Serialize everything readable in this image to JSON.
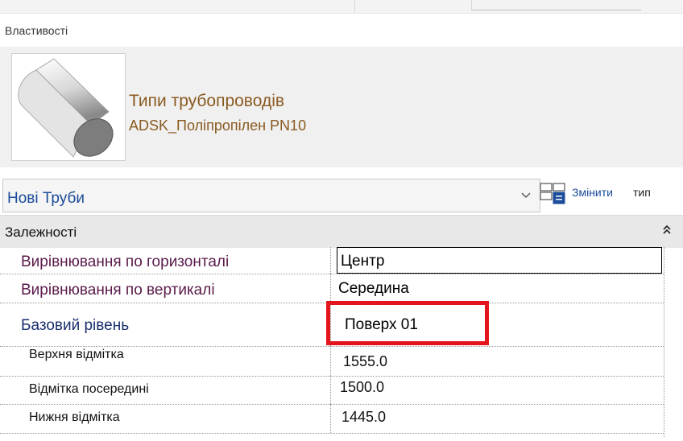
{
  "panel": {
    "title": "Властивості"
  },
  "type_header": {
    "family": "Типи трубопроводів",
    "name": "ADSK_Поліпропілен PN10",
    "thumbnail_icon": "pipe-cylinder-icon"
  },
  "type_selector": {
    "value": "Нові Труби",
    "edit_type_label": "Змінити",
    "edit_type_suffix": "тип"
  },
  "group": {
    "label": "Залежності",
    "collapse_glyph": "⌃"
  },
  "properties": [
    {
      "name": "Вирівнювання по горизонталі",
      "value": "Центр"
    },
    {
      "name": "Вирівнювання по вертикалі",
      "value": "Середина"
    },
    {
      "name": "Базовий рівень",
      "value": "Поверх 01"
    },
    {
      "name": "Верхня відмітка",
      "value": "1555.0"
    },
    {
      "name": "Відмітка посередині",
      "value": "1500.0"
    },
    {
      "name": "Нижня відмітка",
      "value": "1445.0"
    }
  ],
  "colors": {
    "type_text": "#8a5a20",
    "instance_param": "#5a1a4a",
    "link_blue": "#1a4c99",
    "highlight": "#e3141b"
  }
}
